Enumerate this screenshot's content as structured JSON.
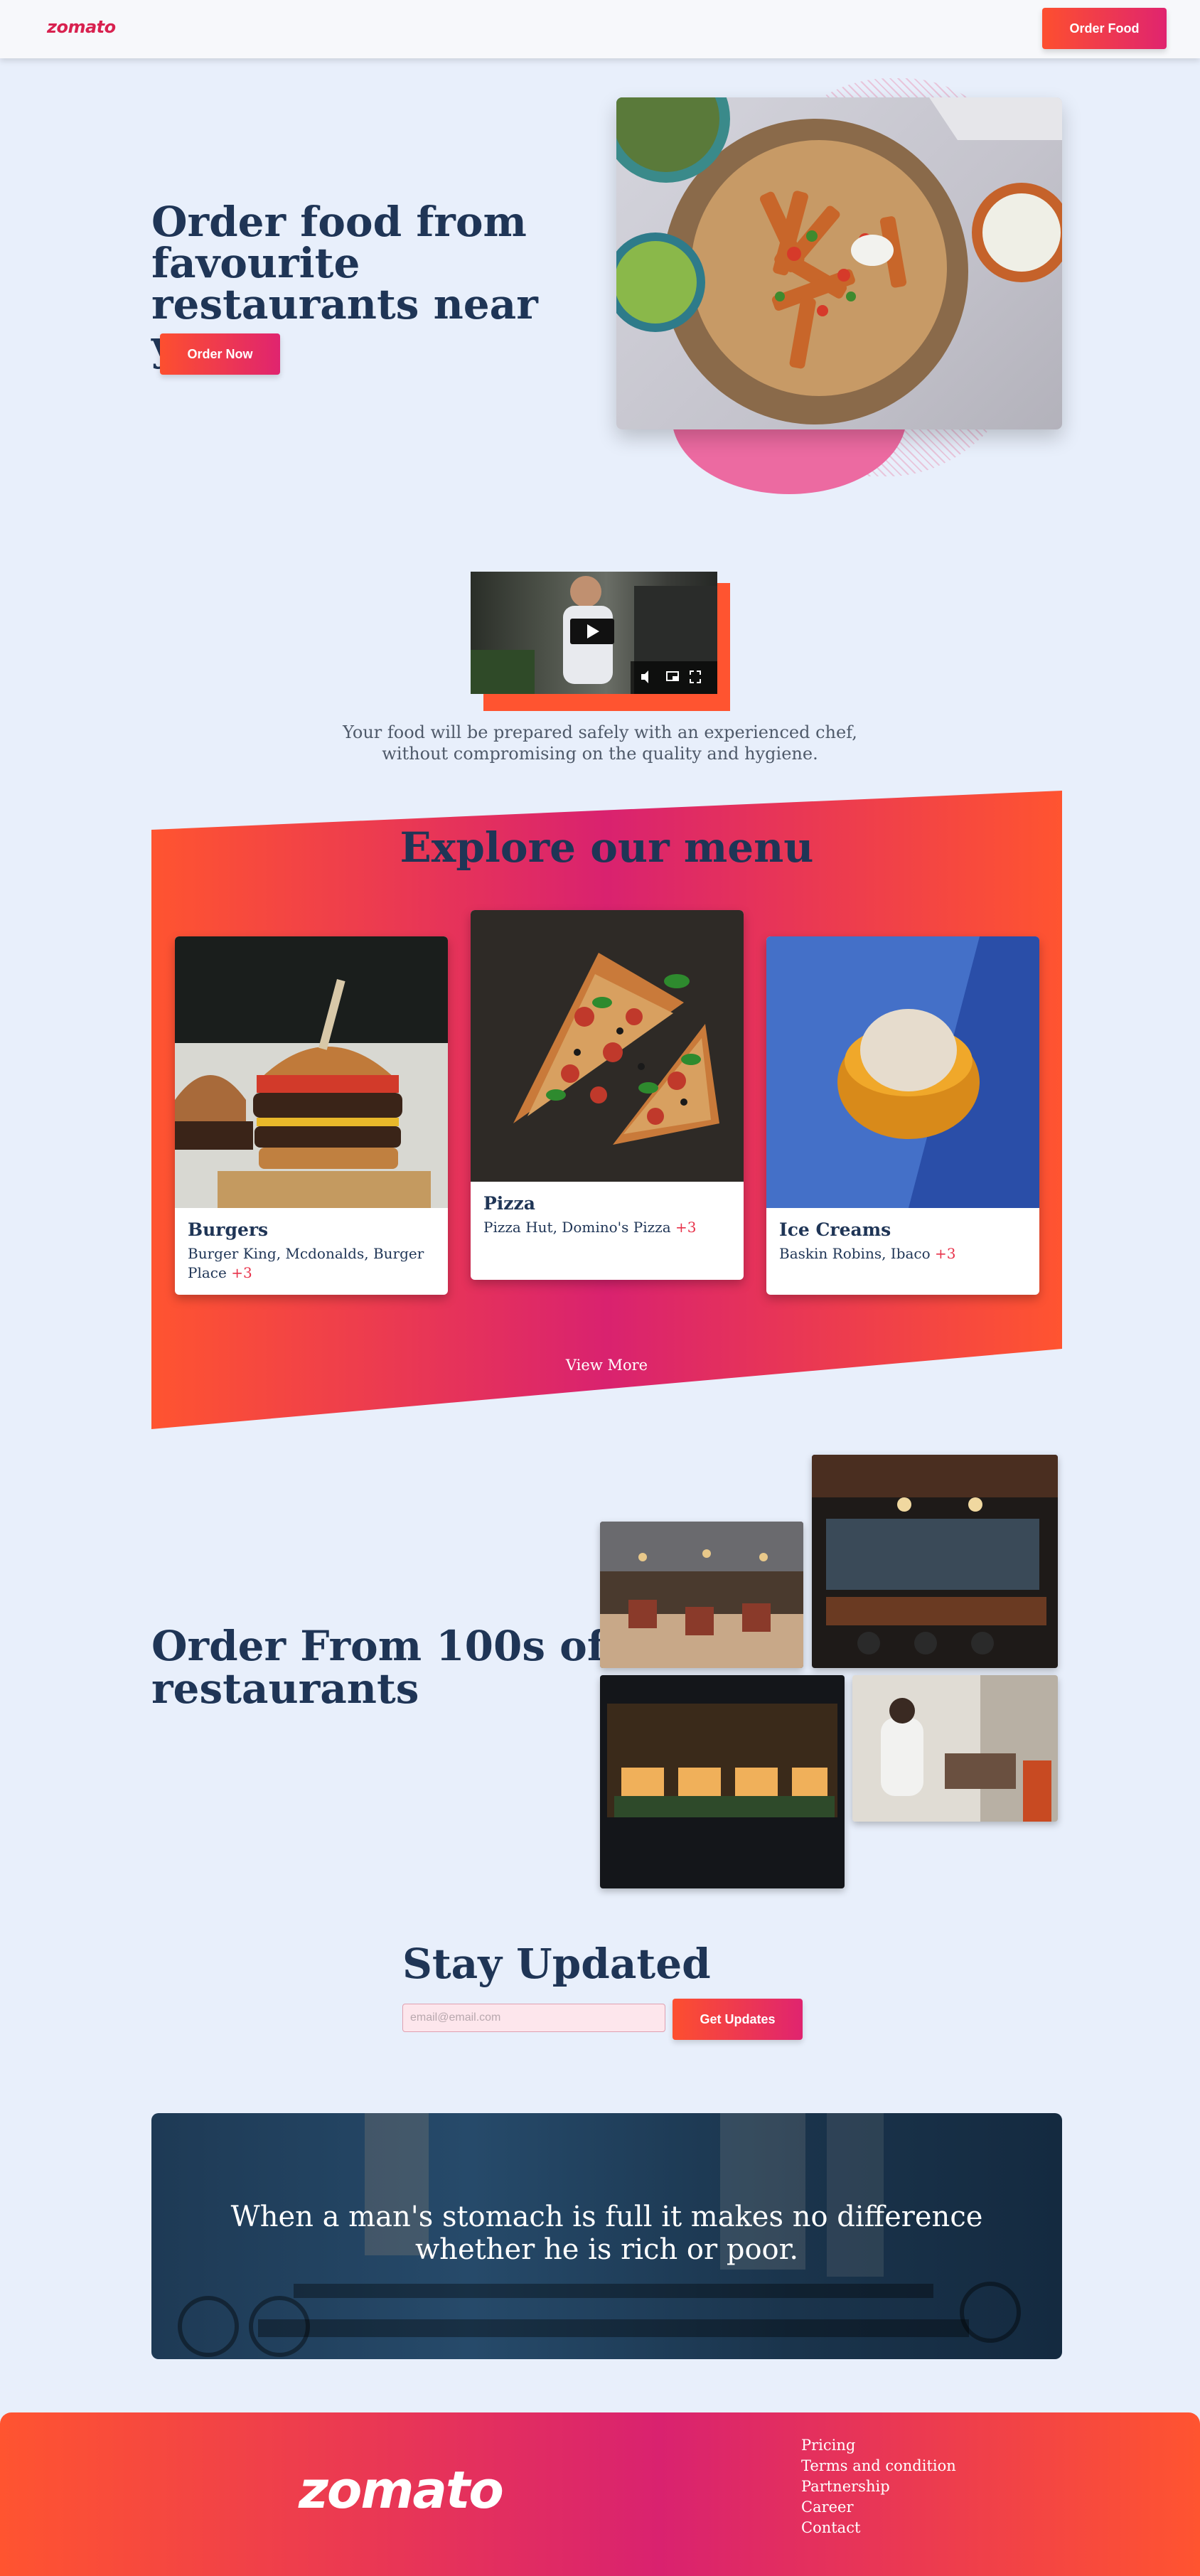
{
  "nav": {
    "logo": "zomato",
    "order_button": "Order Food"
  },
  "hero": {
    "title": "Order food from favourite restaurants near you.",
    "button": "Order Now"
  },
  "video": {
    "caption": "Your food will be prepared safely with an experienced chef, without compromising on the quality and hygiene."
  },
  "menu": {
    "title": "Explore our menu",
    "cards": [
      {
        "title": "Burgers",
        "text": "Burger King, Mcdonalds, Burger Place",
        "extra": "+3"
      },
      {
        "title": "Pizza",
        "text": "Pizza Hut, Domino's Pizza",
        "extra": "+3"
      },
      {
        "title": "Ice Creams",
        "text": "Baskin Robins, Ibaco",
        "extra": "+3"
      }
    ],
    "view_more": "View More"
  },
  "restaurants": {
    "title": "Order From 100s of restaurants"
  },
  "newsletter": {
    "title": "Stay Updated",
    "placeholder": "email@email.com",
    "button": "Get Updates"
  },
  "quote": {
    "text": "When a man's stomach is full it makes no difference whether he is rich or poor."
  },
  "footer": {
    "logo": "zomato",
    "links": [
      "Pricing",
      "Terms and condition",
      "Partnership",
      "Career",
      "Contact"
    ]
  }
}
